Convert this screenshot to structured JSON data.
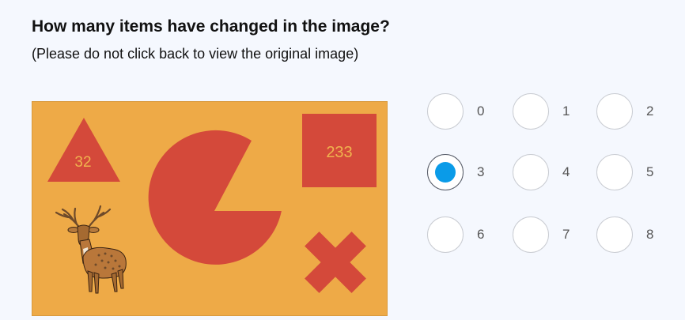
{
  "question": {
    "title": "How many items have changed in the image?",
    "subtitle": "(Please do not click back to view the original image)"
  },
  "scene": {
    "background_color": "#eeaa47",
    "shape_color": "#d4493a",
    "number_color": "#f0b34e",
    "triangle_label": "32",
    "square_label": "233",
    "items": [
      "triangle",
      "pacman-circle",
      "square",
      "deer",
      "cross"
    ]
  },
  "options": [
    {
      "label": "0",
      "selected": false
    },
    {
      "label": "1",
      "selected": false
    },
    {
      "label": "2",
      "selected": false
    },
    {
      "label": "3",
      "selected": true
    },
    {
      "label": "4",
      "selected": false
    },
    {
      "label": "5",
      "selected": false
    },
    {
      "label": "6",
      "selected": false
    },
    {
      "label": "7",
      "selected": false
    },
    {
      "label": "8",
      "selected": false
    }
  ],
  "accent_color": "#0a9be8"
}
